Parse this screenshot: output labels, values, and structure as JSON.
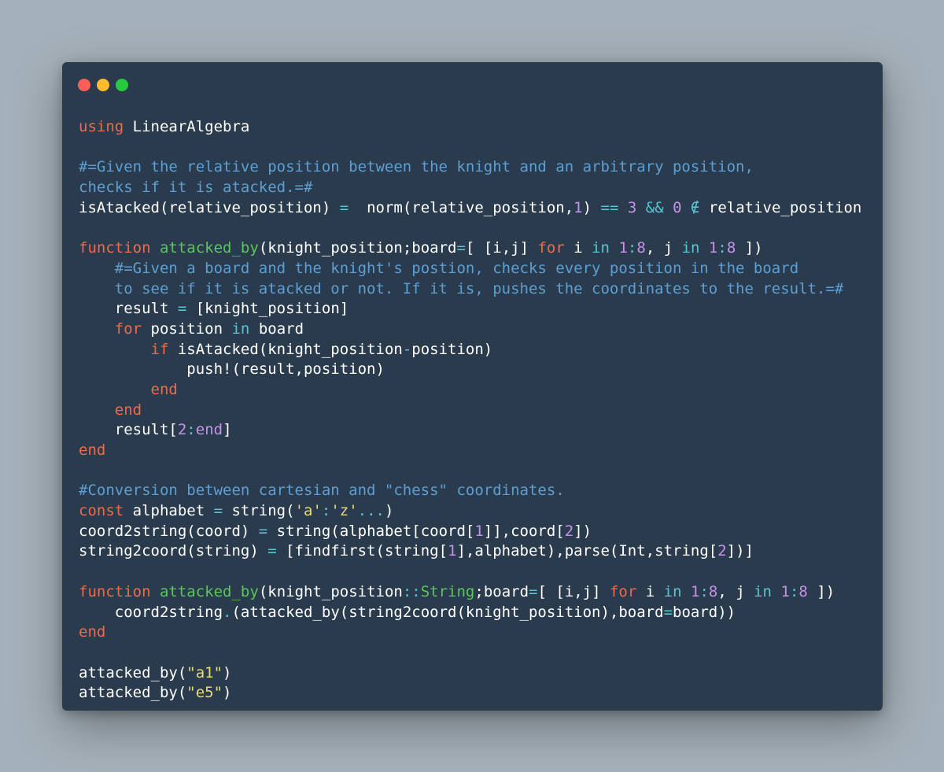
{
  "window": {
    "controls": [
      {
        "name": "close",
        "color": "#ff5f56"
      },
      {
        "name": "minimize",
        "color": "#ffbd2e"
      },
      {
        "name": "maximize",
        "color": "#27c93f"
      }
    ]
  },
  "theme": {
    "background": "#a5b1ba",
    "editor_background": "#2a3b4e",
    "keyword": "#ee6a4b",
    "function_name": "#5bc65b",
    "comment": "#5d9fd3",
    "operator": "#58c5d3",
    "number": "#c792ea",
    "string": "#e6db74",
    "plain": "#ffffff"
  },
  "code": {
    "language": "julia",
    "lines": [
      [
        [
          "kw",
          "using"
        ],
        [
          "pl",
          " LinearAlgebra"
        ]
      ],
      [],
      [
        [
          "cm",
          "#=Given the relative position between the knight and an arbitrary position,"
        ]
      ],
      [
        [
          "cm",
          "checks if it is atacked.=#"
        ]
      ],
      [
        [
          "pl",
          "isAtacked(relative_position) "
        ],
        [
          "op",
          "="
        ],
        [
          "pl",
          "  norm(relative_position,"
        ],
        [
          "num",
          "1"
        ],
        [
          "pl",
          ") "
        ],
        [
          "op",
          "=="
        ],
        [
          "pl",
          " "
        ],
        [
          "num",
          "3"
        ],
        [
          "pl",
          " "
        ],
        [
          "op",
          "&&"
        ],
        [
          "pl",
          " "
        ],
        [
          "num",
          "0"
        ],
        [
          "pl",
          " "
        ],
        [
          "op",
          "∉"
        ],
        [
          "pl",
          " relative_position"
        ]
      ],
      [],
      [
        [
          "kw",
          "function"
        ],
        [
          "pl",
          " "
        ],
        [
          "fn",
          "attacked_by"
        ],
        [
          "pl",
          "(knight_position;board"
        ],
        [
          "op",
          "="
        ],
        [
          "pl",
          "[ [i,j] "
        ],
        [
          "kw",
          "for"
        ],
        [
          "pl",
          " i "
        ],
        [
          "op",
          "in"
        ],
        [
          "pl",
          " "
        ],
        [
          "num",
          "1"
        ],
        [
          "op",
          ":"
        ],
        [
          "num",
          "8"
        ],
        [
          "pl",
          ", j "
        ],
        [
          "op",
          "in"
        ],
        [
          "pl",
          " "
        ],
        [
          "num",
          "1"
        ],
        [
          "op",
          ":"
        ],
        [
          "num",
          "8"
        ],
        [
          "pl",
          " ])"
        ]
      ],
      [
        [
          "pl",
          "    "
        ],
        [
          "cm",
          "#=Given a board and the knight's postion, checks every position in the board"
        ]
      ],
      [
        [
          "cm",
          "    to see if it is atacked or not. If it is, pushes the coordinates to the result.=#"
        ]
      ],
      [
        [
          "pl",
          "    result "
        ],
        [
          "op",
          "="
        ],
        [
          "pl",
          " [knight_position]"
        ]
      ],
      [
        [
          "pl",
          "    "
        ],
        [
          "kw",
          "for"
        ],
        [
          "pl",
          " position "
        ],
        [
          "op",
          "in"
        ],
        [
          "pl",
          " board"
        ]
      ],
      [
        [
          "pl",
          "        "
        ],
        [
          "kw",
          "if"
        ],
        [
          "pl",
          " isAtacked(knight_position"
        ],
        [
          "op",
          "-"
        ],
        [
          "pl",
          "position)"
        ]
      ],
      [
        [
          "pl",
          "            push!(result,position)"
        ]
      ],
      [
        [
          "pl",
          "        "
        ],
        [
          "kw",
          "end"
        ]
      ],
      [
        [
          "pl",
          "    "
        ],
        [
          "kw",
          "end"
        ]
      ],
      [
        [
          "pl",
          "    result["
        ],
        [
          "num",
          "2"
        ],
        [
          "op",
          ":"
        ],
        [
          "num",
          "end"
        ],
        [
          "pl",
          "]"
        ]
      ],
      [
        [
          "kw",
          "end"
        ]
      ],
      [],
      [
        [
          "cm",
          "#Conversion between cartesian and \"chess\" coordinates."
        ]
      ],
      [
        [
          "kw",
          "const"
        ],
        [
          "pl",
          " alphabet "
        ],
        [
          "op",
          "="
        ],
        [
          "pl",
          " string("
        ],
        [
          "str",
          "'a'"
        ],
        [
          "op",
          ":"
        ],
        [
          "str",
          "'z'"
        ],
        [
          "op",
          "..."
        ],
        [
          "pl",
          ")"
        ]
      ],
      [
        [
          "pl",
          "coord2string(coord) "
        ],
        [
          "op",
          "="
        ],
        [
          "pl",
          " string(alphabet[coord["
        ],
        [
          "num",
          "1"
        ],
        [
          "pl",
          "]],coord["
        ],
        [
          "num",
          "2"
        ],
        [
          "pl",
          "])"
        ]
      ],
      [
        [
          "pl",
          "string2coord(string) "
        ],
        [
          "op",
          "="
        ],
        [
          "pl",
          " [findfirst(string["
        ],
        [
          "num",
          "1"
        ],
        [
          "pl",
          "],alphabet),parse(Int,string["
        ],
        [
          "num",
          "2"
        ],
        [
          "pl",
          "])]"
        ]
      ],
      [],
      [
        [
          "kw",
          "function"
        ],
        [
          "pl",
          " "
        ],
        [
          "fn",
          "attacked_by"
        ],
        [
          "pl",
          "(knight_position"
        ],
        [
          "op",
          "::"
        ],
        [
          "fn",
          "String"
        ],
        [
          "pl",
          ";board"
        ],
        [
          "op",
          "="
        ],
        [
          "pl",
          "[ [i,j] "
        ],
        [
          "kw",
          "for"
        ],
        [
          "pl",
          " i "
        ],
        [
          "op",
          "in"
        ],
        [
          "pl",
          " "
        ],
        [
          "num",
          "1"
        ],
        [
          "op",
          ":"
        ],
        [
          "num",
          "8"
        ],
        [
          "pl",
          ", j "
        ],
        [
          "op",
          "in"
        ],
        [
          "pl",
          " "
        ],
        [
          "num",
          "1"
        ],
        [
          "op",
          ":"
        ],
        [
          "num",
          "8"
        ],
        [
          "pl",
          " ])"
        ]
      ],
      [
        [
          "pl",
          "    coord2string"
        ],
        [
          "op",
          "."
        ],
        [
          "pl",
          "(attacked_by(string2coord(knight_position),board"
        ],
        [
          "op",
          "="
        ],
        [
          "pl",
          "board))"
        ]
      ],
      [
        [
          "kw",
          "end"
        ]
      ],
      [],
      [
        [
          "pl",
          "attacked_by("
        ],
        [
          "str",
          "\"a1\""
        ],
        [
          "pl",
          ")"
        ]
      ],
      [
        [
          "pl",
          "attacked_by("
        ],
        [
          "str",
          "\"e5\""
        ],
        [
          "pl",
          ")"
        ]
      ]
    ]
  }
}
